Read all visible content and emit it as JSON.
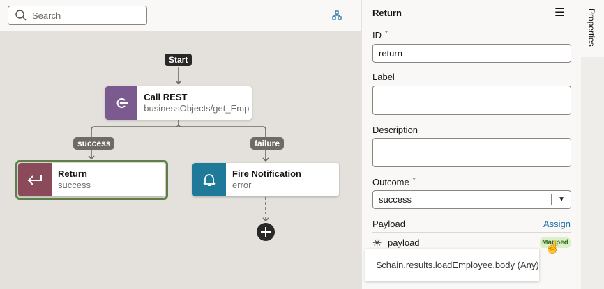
{
  "toolbar": {
    "search_placeholder": "Search",
    "search_icon": "search-icon",
    "layout_icon": "diagram-layout-icon"
  },
  "flow": {
    "start_label": "Start",
    "nodes": [
      {
        "title": "Call REST",
        "subtitle": "businessObjects/get_Emp",
        "icon": "call-rest-icon",
        "color": "#7b5a8f"
      },
      {
        "title": "Return",
        "subtitle": "success",
        "icon": "return-arrow-icon",
        "color": "#8b4a5a",
        "selected": true
      },
      {
        "title": "Fire Notification",
        "subtitle": "error",
        "icon": "bell-icon",
        "color": "#1f7a9a"
      }
    ],
    "edges": [
      {
        "label": "success"
      },
      {
        "label": "failure"
      }
    ],
    "selected_color": "#5e8049"
  },
  "panel": {
    "title": "Return",
    "menu_icon": "hamburger-icon",
    "id_label": "ID",
    "id_value": "return",
    "label_label": "Label",
    "label_value": "",
    "description_label": "Description",
    "description_value": "",
    "outcome_label": "Outcome",
    "outcome_value": "success",
    "required_mark": "*",
    "payload_label": "Payload",
    "assign_link": "Assign",
    "payload_name": "payload",
    "payload_badge": "Mapped",
    "tooltip": "$chain.results.loadEmployee.body (Any)"
  },
  "side_tab": {
    "label": "Properties"
  }
}
